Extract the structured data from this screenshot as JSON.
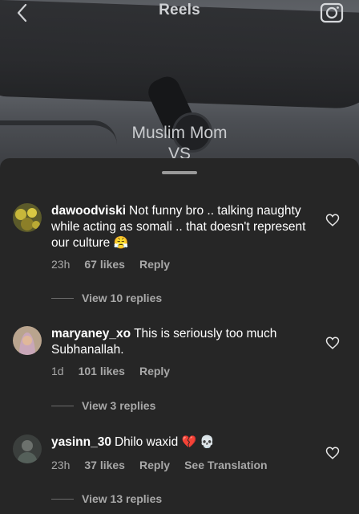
{
  "header": {
    "title": "Reels"
  },
  "video": {
    "caption_line1": "Muslim Mom",
    "caption_line2": "VS"
  },
  "comments": [
    {
      "username": "dawoodviski",
      "text": "Not funny bro .. talking naughty while acting as somali .. that doesn't represent our culture",
      "emoji": "😤",
      "time": "23h",
      "likes": "67 likes",
      "reply_label": "Reply",
      "view_replies": "View 10 replies"
    },
    {
      "username": "maryaney_xo",
      "text": "This is seriously too much Subhanallah.",
      "emoji": "",
      "time": "1d",
      "likes": "101 likes",
      "reply_label": "Reply",
      "view_replies": "View 3 replies"
    },
    {
      "username": "yasinn_30",
      "text": "Dhilo waxid",
      "emoji": "💔 💀",
      "time": "23h",
      "likes": "37 likes",
      "reply_label": "Reply",
      "translation_label": "See Translation",
      "view_replies": "View 13 replies"
    }
  ],
  "icons": {
    "back": "chevron-left-icon",
    "camera": "camera-icon",
    "like": "heart-outline-icon"
  },
  "colors": {
    "sheet": "#262626",
    "text_primary": "#ffffff",
    "text_secondary": "#a8a8a8"
  }
}
